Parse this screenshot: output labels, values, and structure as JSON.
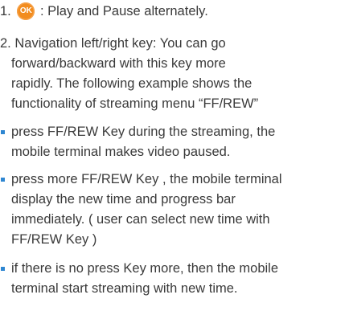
{
  "items": [
    {
      "number": "1.",
      "icon": "ok-button-icon",
      "icon_label": "OK",
      "text": ": Play and Pause alternately."
    },
    {
      "number": "2.",
      "lines": [
        "Navigation left/right key: You can go",
        "forward/backward  with this key more",
        "rapidly. The following example shows the",
        "functionality of streaming menu “FF/REW”"
      ]
    }
  ],
  "bullets": [
    {
      "lines": [
        "press FF/REW Key during the streaming, the",
        "mobile terminal makes video paused."
      ]
    },
    {
      "lines": [
        "press more FF/REW Key , the mobile terminal",
        "display the new time and progress bar",
        "immediately. ( user can select new time with",
        "FF/REW Key )"
      ]
    },
    {
      "lines": [
        "if there is no press Key more, then the mobile",
        "terminal start streaming with new time."
      ]
    }
  ],
  "colors": {
    "text": "#3a3a3a",
    "ok_icon": "#f28c1e",
    "bullet": "#2e86d1"
  }
}
